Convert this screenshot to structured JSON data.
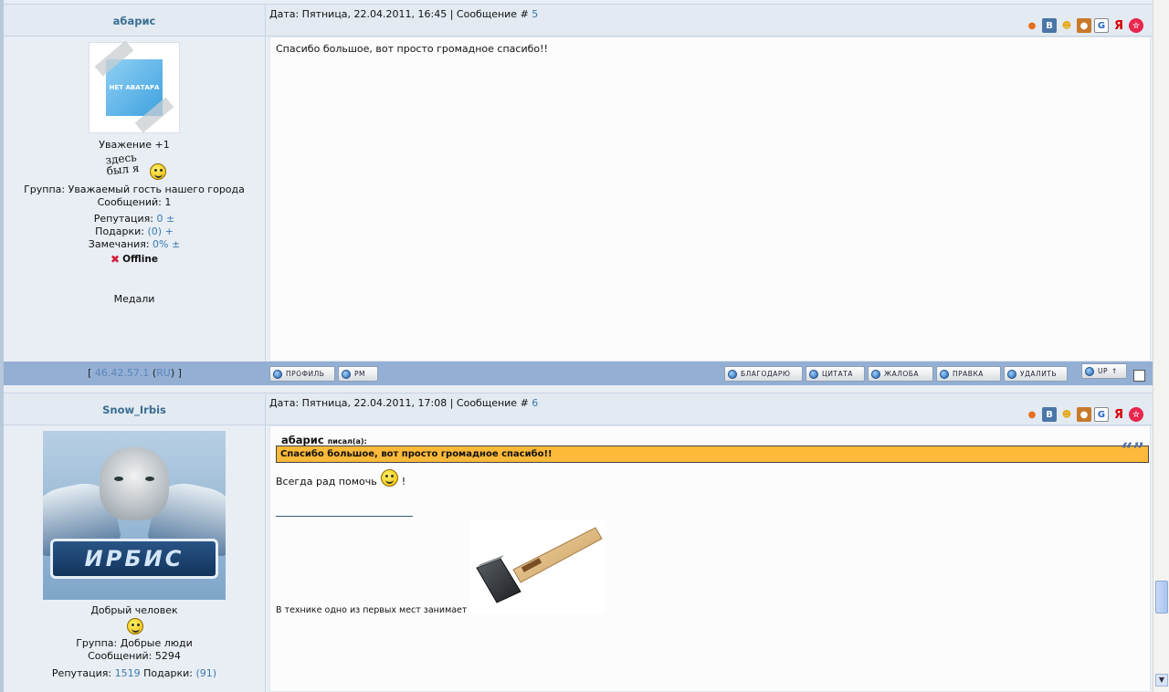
{
  "posts": [
    {
      "author": "абарис",
      "date": "Дата: Пятница, 22.04.2011, 16:45 | Сообщение # ",
      "number": "5",
      "avatar_text": "НЕТ АВАТАРА",
      "respect": "Уважение +1",
      "scribble": "здесь был я",
      "group": "Группа: Уважаемый гость нашего города",
      "messages": "Сообщений: 1",
      "reputation_label": "Репутация:",
      "reputation_value": "0",
      "reputation_pm": "±",
      "gifts_label": "Подарки:",
      "gifts_value": "(0)",
      "gifts_plus": "+",
      "warnings_label": "Замечания:",
      "warnings_value": "0%",
      "warnings_pm": "±",
      "status": "Offline",
      "medals": "Медали",
      "body": "Спасибо большое, вот просто громадное спасибо!!",
      "ip_open": "[ ",
      "ip": "46.42.57.1",
      "ip_country_open": " (",
      "ip_country": "RU",
      "ip_close": ") ]"
    },
    {
      "author": "Snow_Irbis",
      "date": "Дата: Пятница, 22.04.2011, 17:08 | Сообщение # ",
      "number": "6",
      "avatar_text": "ИРБИС",
      "title": "Добрый человек",
      "group": "Группа: Добрые люди",
      "messages": "Сообщений: 5294",
      "reputation_label": "Репутация:",
      "reputation_value": "1519",
      "gifts_label": "Подарки:",
      "gifts_value": "(91)",
      "quote_author": "абарис",
      "quote_suffix": "писал(а):",
      "quote_text": "Спасибо большое, вот просто громадное спасибо!!",
      "reply": "Всегда рад помочь",
      "reply_end": "!",
      "signature": "В технике одно из первых мест занимает"
    }
  ],
  "buttons": {
    "profile": "Профиль",
    "pm": "PM",
    "thanks": "Благодарю",
    "quote": "Цитата",
    "complaint": "Жалоба",
    "edit": "Правка",
    "delete": "Удалить",
    "up": "UP"
  },
  "share_icons": [
    "mail-ru-icon",
    "vkontakte-icon",
    "people-icon",
    "odnoklassniki-icon",
    "google-icon",
    "yandex-icon",
    "favorites-icon"
  ],
  "share_labels": {
    "vk": "B",
    "g": "G",
    "ya": "Я"
  },
  "colors": {
    "header_bg": "#e3eaf2",
    "bar_bg": "#94afd4",
    "quote_bg": "#fdb93a",
    "link": "#3a7ab0"
  }
}
